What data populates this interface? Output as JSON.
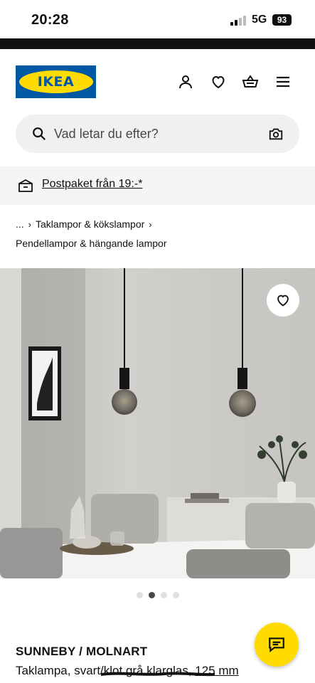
{
  "status_bar": {
    "time": "20:28",
    "network": "5G",
    "battery": "93"
  },
  "header": {
    "logo_text": "IKEA"
  },
  "search": {
    "placeholder": "Vad letar du efter?"
  },
  "delivery": {
    "text": "Postpaket från 19:-*"
  },
  "breadcrumb": {
    "ellipsis": "...",
    "items": [
      "Taklampor & kökslampor",
      "Pendellampor & hängande lampor"
    ]
  },
  "gallery": {
    "image_count": 4,
    "active_index": 1
  },
  "product": {
    "name": "SUNNEBY / MOLNART",
    "description": "Taklampa, svart/klot grå klarglas,",
    "size": "125 mm"
  },
  "colors": {
    "ikea_blue": "#0058a3",
    "ikea_yellow": "#ffdb00"
  },
  "icons": [
    "signal-icon",
    "user-icon",
    "heart-icon",
    "basket-icon",
    "menu-icon",
    "search-icon",
    "camera-icon",
    "truck-box-icon",
    "chevron-right-icon",
    "chat-icon"
  ]
}
